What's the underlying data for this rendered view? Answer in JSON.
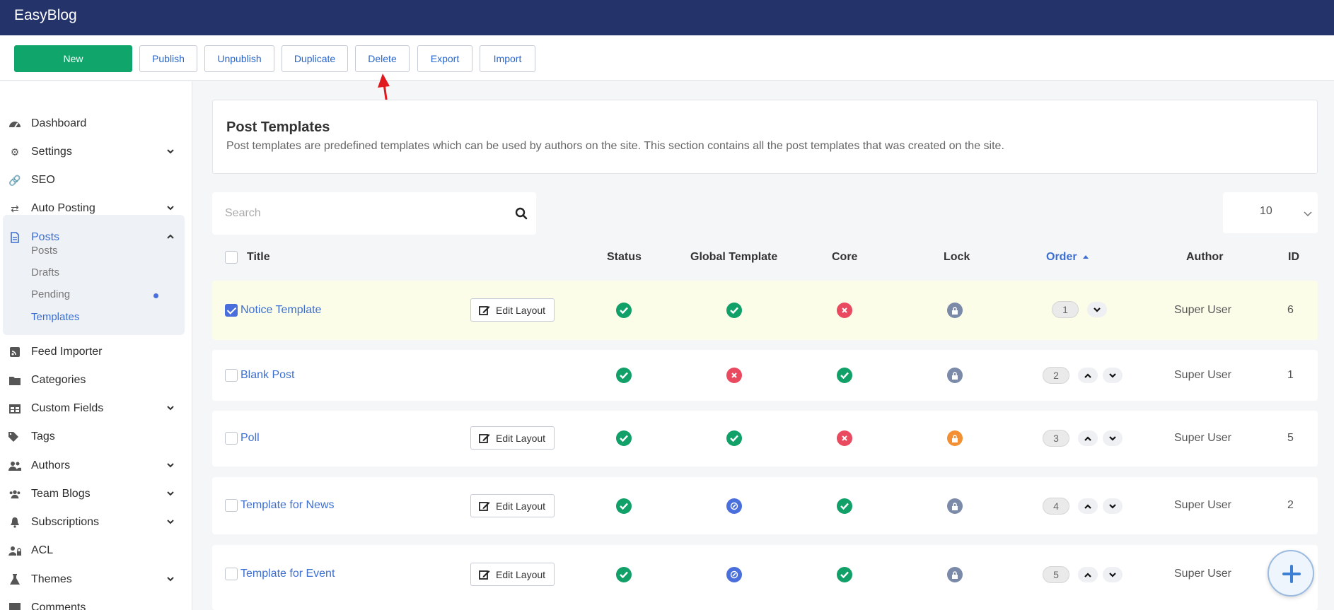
{
  "app": {
    "brand": "EasyBlog"
  },
  "toolbar": {
    "new": "New",
    "publish": "Publish",
    "unpublish": "Unpublish",
    "duplicate": "Duplicate",
    "delete": "Delete",
    "export": "Export",
    "import": "Import"
  },
  "sidebar": {
    "items": [
      {
        "label": "Dashboard",
        "icon": "dashboard-icon"
      },
      {
        "label": "Settings",
        "icon": "gear-icon"
      },
      {
        "label": "SEO",
        "icon": "link-icon"
      },
      {
        "label": "Auto Posting",
        "icon": "retweet-icon"
      },
      {
        "label": "Posts",
        "icon": "document-icon"
      },
      {
        "label": "Feed Importer",
        "icon": "rss-icon"
      },
      {
        "label": "Categories",
        "icon": "folder-icon"
      },
      {
        "label": "Custom Fields",
        "icon": "table-icon"
      },
      {
        "label": "Tags",
        "icon": "tags-icon"
      },
      {
        "label": "Authors",
        "icon": "users-icon"
      },
      {
        "label": "Team Blogs",
        "icon": "team-icon"
      },
      {
        "label": "Subscriptions",
        "icon": "bell-icon"
      },
      {
        "label": "ACL",
        "icon": "user-lock-icon"
      },
      {
        "label": "Themes",
        "icon": "flask-icon"
      },
      {
        "label": "Comments",
        "icon": "comment-icon"
      }
    ],
    "posts_sub": [
      "Posts",
      "Drafts",
      "Pending",
      "Templates"
    ]
  },
  "page": {
    "title": "Post Templates",
    "description": "Post templates are predefined templates which can be used by authors on the site. This section contains all the post templates that was created on the site."
  },
  "search": {
    "placeholder": "Search"
  },
  "per_page": "10",
  "table": {
    "headers": {
      "title": "Title",
      "status": "Status",
      "global": "Global Template",
      "core": "Core",
      "lock": "Lock",
      "order": "Order",
      "author": "Author",
      "id": "ID"
    },
    "edit_label": "Edit Layout",
    "rows": [
      {
        "title": "Notice Template",
        "order": "1",
        "author": "Super User",
        "id": "6"
      },
      {
        "title": "Blank Post",
        "order": "2",
        "author": "Super User",
        "id": "1"
      },
      {
        "title": "Poll",
        "order": "3",
        "author": "Super User",
        "id": "5"
      },
      {
        "title": "Template for News",
        "order": "4",
        "author": "Super User",
        "id": "2"
      },
      {
        "title": "Template for Event",
        "order": "5",
        "author": "Super User",
        "id": ""
      }
    ]
  },
  "colors": {
    "header": "#25336b",
    "primary": "#0fa56b",
    "link": "#3d6fd1",
    "ok": "#10a068",
    "error": "#e94a5f",
    "global": "#4a6fdc",
    "lock": "#7a8aa8",
    "lock_on": "#f29033"
  }
}
